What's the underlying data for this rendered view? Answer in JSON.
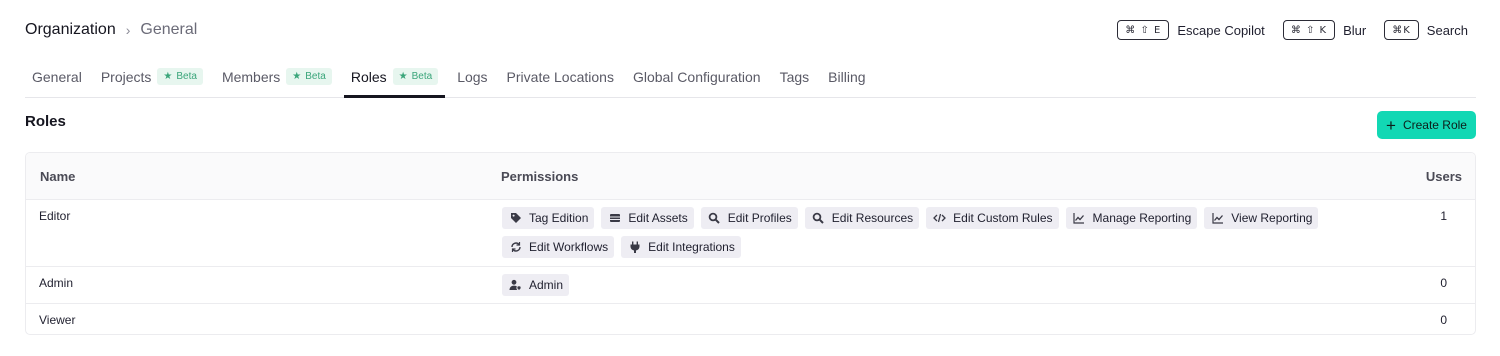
{
  "breadcrumb": {
    "root": "Organization",
    "current": "General"
  },
  "shortcuts": [
    {
      "keys": "⌘ ⇧ E",
      "label": "Escape Copilot"
    },
    {
      "keys": "⌘ ⇧ K",
      "label": "Blur"
    },
    {
      "keys": "⌘K",
      "label": "Search"
    }
  ],
  "tabs": [
    {
      "label": "General",
      "beta": "",
      "active": false
    },
    {
      "label": "Projects",
      "beta": "Beta",
      "active": false
    },
    {
      "label": "Members",
      "beta": "Beta",
      "active": false
    },
    {
      "label": "Roles",
      "beta": "Beta",
      "active": true
    },
    {
      "label": "Logs",
      "beta": "",
      "active": false
    },
    {
      "label": "Private Locations",
      "beta": "",
      "active": false
    },
    {
      "label": "Global Configuration",
      "beta": "",
      "active": false
    },
    {
      "label": "Tags",
      "beta": "",
      "active": false
    },
    {
      "label": "Billing",
      "beta": "",
      "active": false
    }
  ],
  "section": {
    "title": "Roles",
    "create_label": "Create Role"
  },
  "table": {
    "columns": {
      "name": "Name",
      "permissions": "Permissions",
      "users": "Users"
    },
    "rows": [
      {
        "name": "Editor",
        "users": "1",
        "permissions": [
          {
            "label": "Tag Edition",
            "icon": "tag-icon"
          },
          {
            "label": "Edit Assets",
            "icon": "assets-icon"
          },
          {
            "label": "Edit Profiles",
            "icon": "magnifier-icon"
          },
          {
            "label": "Edit Resources",
            "icon": "magnifier-icon"
          },
          {
            "label": "Edit Custom Rules",
            "icon": "code-icon"
          },
          {
            "label": "Manage Reporting",
            "icon": "chart-icon"
          },
          {
            "label": "View Reporting",
            "icon": "chart-icon"
          },
          {
            "label": "Edit Workflows",
            "icon": "workflow-icon"
          },
          {
            "label": "Edit Integrations",
            "icon": "plug-icon"
          }
        ]
      },
      {
        "name": "Admin",
        "users": "0",
        "permissions": [
          {
            "label": "Admin",
            "icon": "admin-user-icon"
          }
        ]
      },
      {
        "name": "Viewer",
        "users": "0",
        "permissions": []
      }
    ]
  }
}
